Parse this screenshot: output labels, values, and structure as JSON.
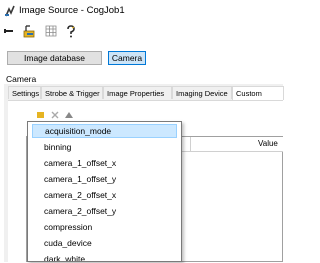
{
  "window": {
    "title": "Image Source - CogJob1"
  },
  "toolbar": {
    "icons": [
      "new-icon",
      "grab-icon",
      "grid-icon",
      "help-icon"
    ]
  },
  "buttons": {
    "image_database": "Image database",
    "camera": "Camera"
  },
  "group": {
    "label": "Camera"
  },
  "tabs": [
    "Settings",
    "Strobe & Trigger",
    "Image Properties",
    "Imaging Device",
    "Custom"
  ],
  "grid": {
    "value_header": "Value"
  },
  "dropdown": {
    "items": [
      "acquisition_mode",
      "binning",
      "camera_1_offset_x",
      "camera_1_offset_y",
      "camera_2_offset_x",
      "camera_2_offset_y",
      "compression",
      "cuda_device",
      "dark_white"
    ],
    "selected_index": 0
  },
  "colors": {
    "selection": "#cce8ff",
    "active_button": "#cce4f7"
  }
}
